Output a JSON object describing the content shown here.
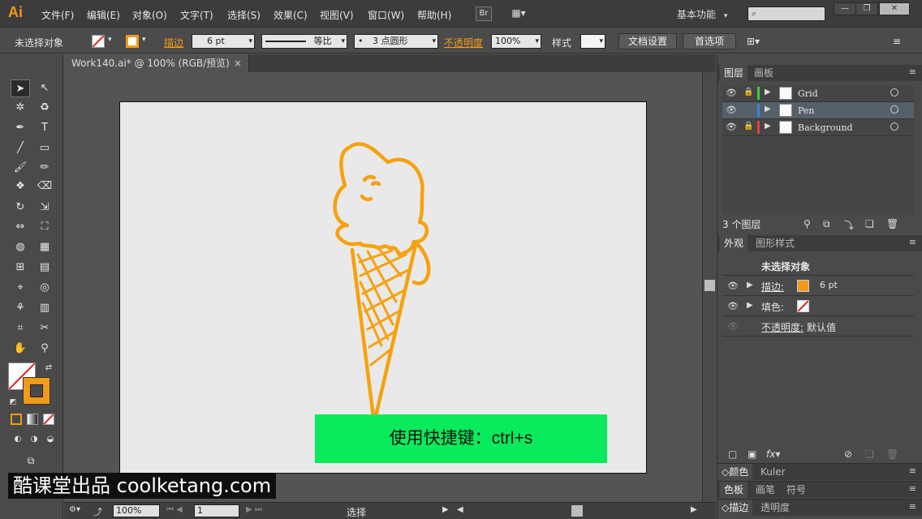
{
  "app": {
    "logo": "Ai"
  },
  "menus": [
    "文件(F)",
    "编辑(E)",
    "对象(O)",
    "文字(T)",
    "选择(S)",
    "效果(C)",
    "视图(V)",
    "窗口(W)",
    "帮助(H)"
  ],
  "menubar": {
    "bridge_label": "Br",
    "arrange_label": "▦▾",
    "workspace": "基本功能",
    "workspace_arrow": "▾",
    "search_icon": "search-icon",
    "search_glyph": "⌕"
  },
  "window_controls": {
    "minimize": "—",
    "restore": "❐",
    "close": "✕"
  },
  "control_bar": {
    "selection_status": "未选择对象",
    "stroke_label": "描边",
    "stroke_weight": "6 pt",
    "stroke_profile": "等比",
    "brush": "3 点圆形",
    "opacity_label": "不透明度",
    "opacity_value": "100%",
    "style_label": "样式",
    "doc_setup_button": "文档设置",
    "preferences_button": "首选项",
    "arrow": "▾",
    "stroke_color": "#f29a1a",
    "fill_color": "none"
  },
  "document": {
    "tab_title": "Work140.ai* @ 100% (RGB/预览)",
    "close_glyph": "×",
    "shortcut_banner": "使用快捷键：ctrl+s",
    "banner_color": "#09ea5c",
    "artwork": "ice-cream-cone",
    "artwork_color": "#f7a10e"
  },
  "status_bar": {
    "zoom": "100%",
    "artboard_number": "1",
    "tool": "选择"
  },
  "panels": {
    "layers_tabs": [
      "图层",
      "画板"
    ],
    "layers": [
      {
        "name": "Grid",
        "color": "#3ccc3c",
        "locked": true,
        "selected": false
      },
      {
        "name": "Pen",
        "color": "#3c7fe0",
        "locked": false,
        "selected": true
      },
      {
        "name": "Background",
        "color": "#e04040",
        "locked": true,
        "selected": false
      }
    ],
    "layer_count": "3 个图层",
    "appearance_tabs": [
      "外观",
      "图形样式"
    ],
    "appearance": {
      "title": "未选择对象",
      "stroke_label": "描边:",
      "stroke_weight": "6 pt",
      "fill_label": "填色:",
      "opacity_label": "不透明度:",
      "opacity_value": "默认值"
    },
    "color_tabs": [
      "颜色",
      "Kuler"
    ],
    "swatch_tabs": [
      "色板",
      "画笔",
      "符号"
    ],
    "stroke_tabs": [
      "描边",
      "透明度"
    ]
  },
  "watermark": "酷课堂出品 coolketang.com"
}
